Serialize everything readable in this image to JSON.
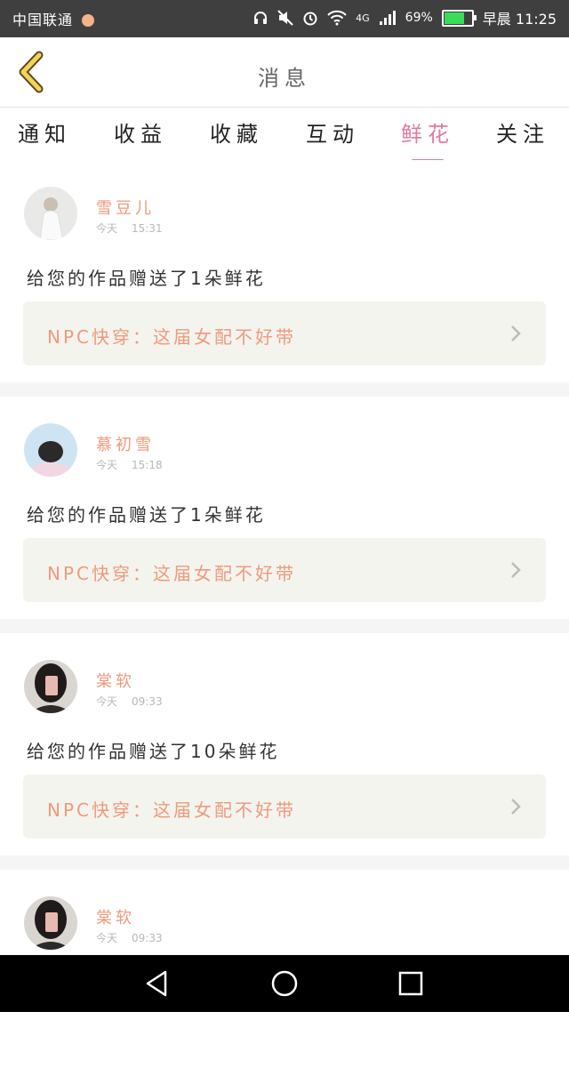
{
  "status_bar": {
    "carrier": "中国联通",
    "network": "4G",
    "battery": "69%",
    "battery_level": 0.69,
    "time": "早晨 11:25"
  },
  "header": {
    "back_icon": "chevron-left-icon",
    "title": "消息"
  },
  "tabs": [
    {
      "label": "通知",
      "active": false
    },
    {
      "label": "收益",
      "active": false
    },
    {
      "label": "收藏",
      "active": false
    },
    {
      "label": "互动",
      "active": false
    },
    {
      "label": "鲜花",
      "active": true
    },
    {
      "label": "关注",
      "active": false
    }
  ],
  "messages": [
    {
      "name": "雪豆儿",
      "day": "今天",
      "time": "15:31",
      "text": "给您的作品赠送了1朵鲜花",
      "work_title": "NPC快穿：这届女配不好带"
    },
    {
      "name": "慕初雪",
      "day": "今天",
      "time": "15:18",
      "text": "给您的作品赠送了1朵鲜花",
      "work_title": "NPC快穿：这届女配不好带"
    },
    {
      "name": "棠软",
      "day": "今天",
      "time": "09:33",
      "text": "给您的作品赠送了10朵鲜花",
      "work_title": "NPC快穿：这届女配不好带"
    },
    {
      "name": "棠软",
      "day": "今天",
      "time": "09:33",
      "text": "",
      "work_title": ""
    }
  ],
  "nav_bar": {
    "back_icon": "triangle-back-icon",
    "home_icon": "circle-home-icon",
    "recents_icon": "square-recents-icon"
  },
  "colors": {
    "accent": "#e07aa1",
    "name": "#ef9a7c",
    "status_bg": "#3f3f3f"
  }
}
